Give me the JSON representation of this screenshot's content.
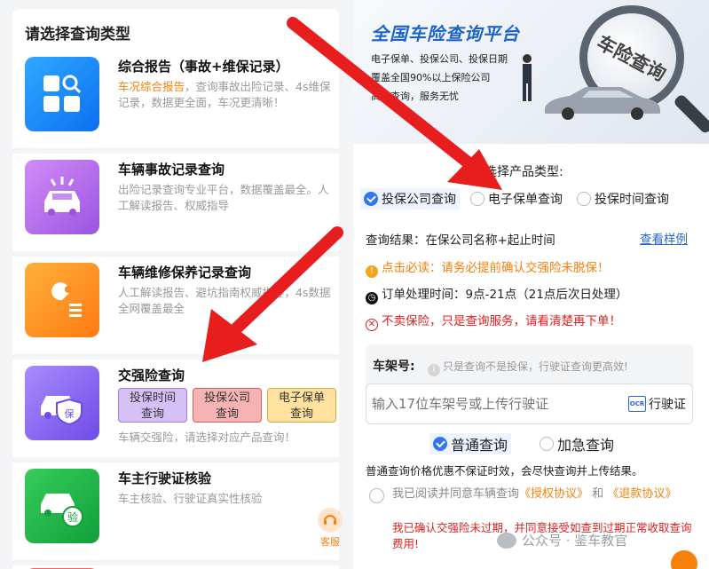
{
  "left": {
    "title": "请选择查询类型",
    "cards": [
      {
        "title": "综合报告（事故+维保记录）",
        "highlight": "车况综合报告",
        "desc": "，查询事故出险记录、4s维保记录，数据更全面，车况更清晰！",
        "icon": "grid-search-icon",
        "color": "#1a8cff"
      },
      {
        "title": "车辆事故记录查询",
        "desc": "出险记录查询专业平台，数据覆盖最全。人工解读报告、权威指导",
        "icon": "car-crash-icon",
        "color": "#b06ae8"
      },
      {
        "title": "车辆维修保养记录查询",
        "desc": "人工解读报告、避坑指南权威指导，4s数据全网覆盖最全",
        "icon": "wrench-icon",
        "color": "#ff8a1f"
      },
      {
        "title": "交强险查询",
        "tags": [
          "投保时间\n查询",
          "投保公司\n查询",
          "电子保单\n查询"
        ],
        "desc": "车辆交强险，请选择对应产品查询！",
        "icon": "car-shield-icon",
        "color": "#8a6cf0"
      },
      {
        "title": "车主行驶证核验",
        "desc": "车主核验、行驶证真实性核验",
        "icon": "car-check-icon",
        "color": "#22b24c"
      }
    ],
    "service_label": "客服"
  },
  "banner": {
    "title": "全国车险查询平台",
    "lines": [
      "电子保单、投保公司、投保日期",
      "覆盖全国90%以上保险公司",
      "高效查询，服务无忧"
    ],
    "magnifier_text": "车险查询"
  },
  "product": {
    "label": "选择产品类型:",
    "options": [
      "投保公司查询",
      "电子保单查询",
      "投保时间查询"
    ],
    "selected": 0
  },
  "info": {
    "result": "查询结果：在保公司名称+起止时间",
    "sample_link": "查看样例",
    "warning": "点击必读：请务必提前确认交强险未脱保！",
    "hours": "订单处理时间：9点-21点（21点后次日处理）",
    "no_sale": "不卖保险，只是查询服务，请看清楚再下单！"
  },
  "form": {
    "label": "车架号:",
    "hint": "只是查询不是投保，行驶证查询更高效!",
    "placeholder": "输入17位车架号或上传行驶证",
    "ocr_label": "行驶证",
    "ocr_icon_text": "OCR"
  },
  "speed": {
    "options": [
      "普通查询",
      "加急查询"
    ],
    "selected": 0,
    "note": "普通查询价格优惠不保证时效，会尽快查询并上传结果。"
  },
  "agree": {
    "prefix": "我已阅读并同意车辆查询",
    "link1": "《授权协议》",
    "and": "和",
    "link2": "《退款协议》",
    "red": "我已确认交强险未过期，并同意接受如查到过期正常收取查询费用!"
  },
  "watermark": "公众号 · 鉴车教官"
}
